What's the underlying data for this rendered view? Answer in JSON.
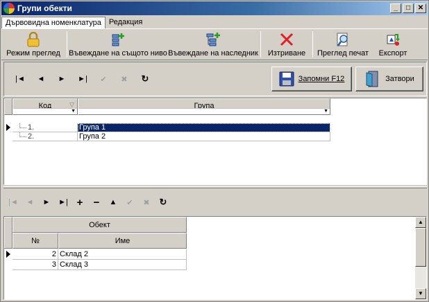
{
  "window": {
    "title": "Групи обекти",
    "minimize": "_",
    "maximize": "□",
    "close": "✕"
  },
  "menu": {
    "tabs": [
      "Дървовидна номенклатура",
      "Редакция"
    ]
  },
  "ribbon": {
    "view_mode": "Режим преглед",
    "insert_same_level": "Въвеждане на същото ниво",
    "insert_child": "Въвеждане на наследник",
    "delete": "Изтриване",
    "print_preview": "Преглед печат",
    "export": "Експорт"
  },
  "nav": {
    "first": "|◄",
    "prev": "◄",
    "next": "►",
    "last": "►|",
    "post": "✔",
    "cancel": "✖",
    "refresh": "↻",
    "insert": "+",
    "delete": "−",
    "up": "▲"
  },
  "actions": {
    "save_label": "Запомни  F12",
    "close_label": "Затвори"
  },
  "groups_grid": {
    "col_code": "Код",
    "col_group": "Група",
    "rows": [
      {
        "code": "1.",
        "group": "Група 1"
      },
      {
        "code": "2.",
        "group": "Група 2"
      }
    ]
  },
  "objects_grid": {
    "band": "Обект",
    "col_num": "№",
    "col_name": "Име",
    "rows": [
      {
        "num": "2",
        "name": "Склад 2"
      },
      {
        "num": "3",
        "name": "Склад 3"
      }
    ]
  },
  "colors": {
    "title_start": "#0a246a",
    "title_end": "#a6caf0",
    "selection": "#0a246a",
    "delete_icon": "#e02020"
  },
  "icons": [
    "lock-icon",
    "insert-sibling-icon",
    "insert-child-icon",
    "delete-x-icon",
    "print-preview-icon",
    "export-icon",
    "floppy-save-icon",
    "exit-door-icon"
  ]
}
